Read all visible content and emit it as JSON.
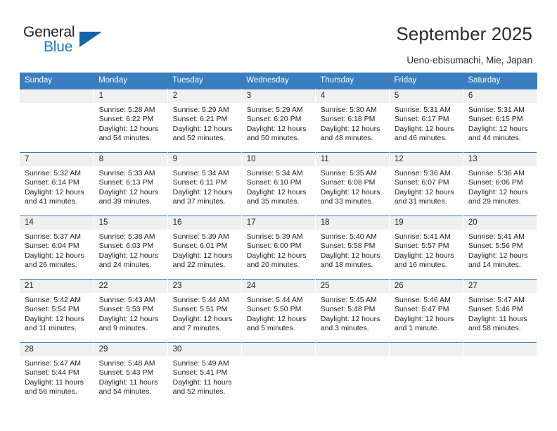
{
  "brand": {
    "name_part1": "General",
    "name_part2": "Blue",
    "accent_color": "#1a7ac4",
    "triangle_color": "#1763a8",
    "logo_icon": "triangle-icon"
  },
  "header": {
    "title": "September 2025",
    "subtitle": "Ueno-ebisumachi, Mie, Japan"
  },
  "calendar": {
    "header_bg": "#3a7ebf",
    "daynum_bg": "#f0f0f0",
    "weekday_headers": [
      "Sunday",
      "Monday",
      "Tuesday",
      "Wednesday",
      "Thursday",
      "Friday",
      "Saturday"
    ],
    "weeks": [
      [
        {
          "day": "",
          "empty": true,
          "sunrise": "",
          "sunset": "",
          "daylight_line1": "",
          "daylight_line2": ""
        },
        {
          "day": "1",
          "empty": false,
          "sunrise": "Sunrise: 5:28 AM",
          "sunset": "Sunset: 6:22 PM",
          "daylight_line1": "Daylight: 12 hours",
          "daylight_line2": "and 54 minutes."
        },
        {
          "day": "2",
          "empty": false,
          "sunrise": "Sunrise: 5:29 AM",
          "sunset": "Sunset: 6:21 PM",
          "daylight_line1": "Daylight: 12 hours",
          "daylight_line2": "and 52 minutes."
        },
        {
          "day": "3",
          "empty": false,
          "sunrise": "Sunrise: 5:29 AM",
          "sunset": "Sunset: 6:20 PM",
          "daylight_line1": "Daylight: 12 hours",
          "daylight_line2": "and 50 minutes."
        },
        {
          "day": "4",
          "empty": false,
          "sunrise": "Sunrise: 5:30 AM",
          "sunset": "Sunset: 6:18 PM",
          "daylight_line1": "Daylight: 12 hours",
          "daylight_line2": "and 48 minutes."
        },
        {
          "day": "5",
          "empty": false,
          "sunrise": "Sunrise: 5:31 AM",
          "sunset": "Sunset: 6:17 PM",
          "daylight_line1": "Daylight: 12 hours",
          "daylight_line2": "and 46 minutes."
        },
        {
          "day": "6",
          "empty": false,
          "sunrise": "Sunrise: 5:31 AM",
          "sunset": "Sunset: 6:15 PM",
          "daylight_line1": "Daylight: 12 hours",
          "daylight_line2": "and 44 minutes."
        }
      ],
      [
        {
          "day": "7",
          "empty": false,
          "sunrise": "Sunrise: 5:32 AM",
          "sunset": "Sunset: 6:14 PM",
          "daylight_line1": "Daylight: 12 hours",
          "daylight_line2": "and 41 minutes."
        },
        {
          "day": "8",
          "empty": false,
          "sunrise": "Sunrise: 5:33 AM",
          "sunset": "Sunset: 6:13 PM",
          "daylight_line1": "Daylight: 12 hours",
          "daylight_line2": "and 39 minutes."
        },
        {
          "day": "9",
          "empty": false,
          "sunrise": "Sunrise: 5:34 AM",
          "sunset": "Sunset: 6:11 PM",
          "daylight_line1": "Daylight: 12 hours",
          "daylight_line2": "and 37 minutes."
        },
        {
          "day": "10",
          "empty": false,
          "sunrise": "Sunrise: 5:34 AM",
          "sunset": "Sunset: 6:10 PM",
          "daylight_line1": "Daylight: 12 hours",
          "daylight_line2": "and 35 minutes."
        },
        {
          "day": "11",
          "empty": false,
          "sunrise": "Sunrise: 5:35 AM",
          "sunset": "Sunset: 6:08 PM",
          "daylight_line1": "Daylight: 12 hours",
          "daylight_line2": "and 33 minutes."
        },
        {
          "day": "12",
          "empty": false,
          "sunrise": "Sunrise: 5:36 AM",
          "sunset": "Sunset: 6:07 PM",
          "daylight_line1": "Daylight: 12 hours",
          "daylight_line2": "and 31 minutes."
        },
        {
          "day": "13",
          "empty": false,
          "sunrise": "Sunrise: 5:36 AM",
          "sunset": "Sunset: 6:06 PM",
          "daylight_line1": "Daylight: 12 hours",
          "daylight_line2": "and 29 minutes."
        }
      ],
      [
        {
          "day": "14",
          "empty": false,
          "sunrise": "Sunrise: 5:37 AM",
          "sunset": "Sunset: 6:04 PM",
          "daylight_line1": "Daylight: 12 hours",
          "daylight_line2": "and 26 minutes."
        },
        {
          "day": "15",
          "empty": false,
          "sunrise": "Sunrise: 5:38 AM",
          "sunset": "Sunset: 6:03 PM",
          "daylight_line1": "Daylight: 12 hours",
          "daylight_line2": "and 24 minutes."
        },
        {
          "day": "16",
          "empty": false,
          "sunrise": "Sunrise: 5:39 AM",
          "sunset": "Sunset: 6:01 PM",
          "daylight_line1": "Daylight: 12 hours",
          "daylight_line2": "and 22 minutes."
        },
        {
          "day": "17",
          "empty": false,
          "sunrise": "Sunrise: 5:39 AM",
          "sunset": "Sunset: 6:00 PM",
          "daylight_line1": "Daylight: 12 hours",
          "daylight_line2": "and 20 minutes."
        },
        {
          "day": "18",
          "empty": false,
          "sunrise": "Sunrise: 5:40 AM",
          "sunset": "Sunset: 5:58 PM",
          "daylight_line1": "Daylight: 12 hours",
          "daylight_line2": "and 18 minutes."
        },
        {
          "day": "19",
          "empty": false,
          "sunrise": "Sunrise: 5:41 AM",
          "sunset": "Sunset: 5:57 PM",
          "daylight_line1": "Daylight: 12 hours",
          "daylight_line2": "and 16 minutes."
        },
        {
          "day": "20",
          "empty": false,
          "sunrise": "Sunrise: 5:41 AM",
          "sunset": "Sunset: 5:56 PM",
          "daylight_line1": "Daylight: 12 hours",
          "daylight_line2": "and 14 minutes."
        }
      ],
      [
        {
          "day": "21",
          "empty": false,
          "sunrise": "Sunrise: 5:42 AM",
          "sunset": "Sunset: 5:54 PM",
          "daylight_line1": "Daylight: 12 hours",
          "daylight_line2": "and 11 minutes."
        },
        {
          "day": "22",
          "empty": false,
          "sunrise": "Sunrise: 5:43 AM",
          "sunset": "Sunset: 5:53 PM",
          "daylight_line1": "Daylight: 12 hours",
          "daylight_line2": "and 9 minutes."
        },
        {
          "day": "23",
          "empty": false,
          "sunrise": "Sunrise: 5:44 AM",
          "sunset": "Sunset: 5:51 PM",
          "daylight_line1": "Daylight: 12 hours",
          "daylight_line2": "and 7 minutes."
        },
        {
          "day": "24",
          "empty": false,
          "sunrise": "Sunrise: 5:44 AM",
          "sunset": "Sunset: 5:50 PM",
          "daylight_line1": "Daylight: 12 hours",
          "daylight_line2": "and 5 minutes."
        },
        {
          "day": "25",
          "empty": false,
          "sunrise": "Sunrise: 5:45 AM",
          "sunset": "Sunset: 5:48 PM",
          "daylight_line1": "Daylight: 12 hours",
          "daylight_line2": "and 3 minutes."
        },
        {
          "day": "26",
          "empty": false,
          "sunrise": "Sunrise: 5:46 AM",
          "sunset": "Sunset: 5:47 PM",
          "daylight_line1": "Daylight: 12 hours",
          "daylight_line2": "and 1 minute."
        },
        {
          "day": "27",
          "empty": false,
          "sunrise": "Sunrise: 5:47 AM",
          "sunset": "Sunset: 5:46 PM",
          "daylight_line1": "Daylight: 11 hours",
          "daylight_line2": "and 58 minutes."
        }
      ],
      [
        {
          "day": "28",
          "empty": false,
          "sunrise": "Sunrise: 5:47 AM",
          "sunset": "Sunset: 5:44 PM",
          "daylight_line1": "Daylight: 11 hours",
          "daylight_line2": "and 56 minutes."
        },
        {
          "day": "29",
          "empty": false,
          "sunrise": "Sunrise: 5:48 AM",
          "sunset": "Sunset: 5:43 PM",
          "daylight_line1": "Daylight: 11 hours",
          "daylight_line2": "and 54 minutes."
        },
        {
          "day": "30",
          "empty": false,
          "sunrise": "Sunrise: 5:49 AM",
          "sunset": "Sunset: 5:41 PM",
          "daylight_line1": "Daylight: 11 hours",
          "daylight_line2": "and 52 minutes."
        },
        {
          "day": "",
          "empty": true,
          "sunrise": "",
          "sunset": "",
          "daylight_line1": "",
          "daylight_line2": ""
        },
        {
          "day": "",
          "empty": true,
          "sunrise": "",
          "sunset": "",
          "daylight_line1": "",
          "daylight_line2": ""
        },
        {
          "day": "",
          "empty": true,
          "sunrise": "",
          "sunset": "",
          "daylight_line1": "",
          "daylight_line2": ""
        },
        {
          "day": "",
          "empty": true,
          "sunrise": "",
          "sunset": "",
          "daylight_line1": "",
          "daylight_line2": ""
        }
      ]
    ]
  }
}
